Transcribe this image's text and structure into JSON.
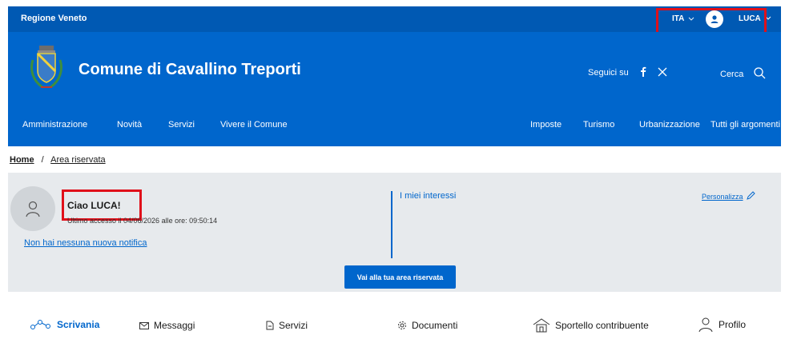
{
  "topbar": {
    "region": "Regione Veneto",
    "language": "ITA",
    "user_name": "LUCA"
  },
  "header": {
    "title": "Comune di Cavallino Treporti",
    "follow_label": "Seguici su",
    "search_label": "Cerca"
  },
  "nav": {
    "left": [
      "Amministrazione",
      "Novità",
      "Servizi",
      "Vivere il Comune"
    ],
    "right": [
      "Imposte",
      "Turismo",
      "Urbanizzazione",
      "Tutti gli argomenti..."
    ]
  },
  "breadcrumb": {
    "home": "Home",
    "separator": "/",
    "current": "Area riservata"
  },
  "profile_panel": {
    "greeting": "Ciao LUCA!",
    "last_access": "Ultimo accesso il 04/06/2026 alle ore: 09:50:14",
    "notifications": "Non hai nessuna nuova notifica",
    "interests_title": "I miei interessi",
    "personalize": "Personalizza",
    "cta": "Vai alla tua area riservata"
  },
  "tabs": [
    {
      "label": "Scrivania",
      "icon": "network-icon",
      "active": true
    },
    {
      "label": "Messaggi",
      "icon": "mail-icon",
      "active": false
    },
    {
      "label": "Servizi",
      "icon": "doc-icon",
      "active": false
    },
    {
      "label": "Documenti",
      "icon": "gear-icon",
      "active": false
    },
    {
      "label": "Sportello contribuente",
      "icon": "building-icon",
      "active": false
    },
    {
      "label": "Profilo",
      "icon": "user-icon",
      "active": false
    }
  ],
  "colors": {
    "primary": "#0066cc",
    "topbar": "#0059b3",
    "panel": "#e7eaed",
    "highlight": "#e0101a"
  }
}
